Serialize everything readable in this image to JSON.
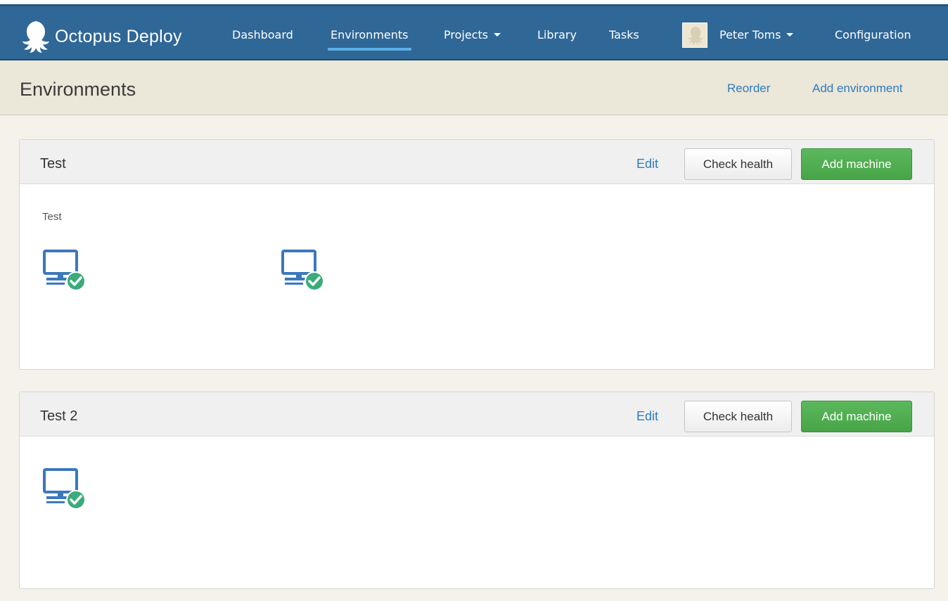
{
  "app": {
    "brand_name": "Octopus Deploy"
  },
  "nav": {
    "items": [
      {
        "label": "Dashboard"
      },
      {
        "label": "Environments"
      },
      {
        "label": "Projects"
      },
      {
        "label": "Library"
      },
      {
        "label": "Tasks"
      }
    ],
    "user_name": "Peter Toms",
    "configuration_label": "Configuration"
  },
  "header": {
    "title": "Environments",
    "reorder_label": "Reorder",
    "add_environment_label": "Add environment"
  },
  "environments": [
    {
      "name": "Test",
      "description": "Test",
      "edit_label": "Edit",
      "check_health_label": "Check health",
      "add_machine_label": "Add machine",
      "machine_icons": [
        "monitor-healthy-icon",
        "monitor-healthy-icon"
      ]
    },
    {
      "name": "Test 2",
      "description": "",
      "edit_label": "Edit",
      "check_health_label": "Check health",
      "add_machine_label": "Add machine",
      "machine_icons": [
        "monitor-healthy-icon"
      ]
    }
  ],
  "colors": {
    "navbar": "#2f6797",
    "active_underline": "#5bb0e6",
    "link": "#2e7bc0",
    "success": "#5cb85c",
    "machine_icon": "#3a78bd",
    "health_ok": "#3bab7b"
  }
}
